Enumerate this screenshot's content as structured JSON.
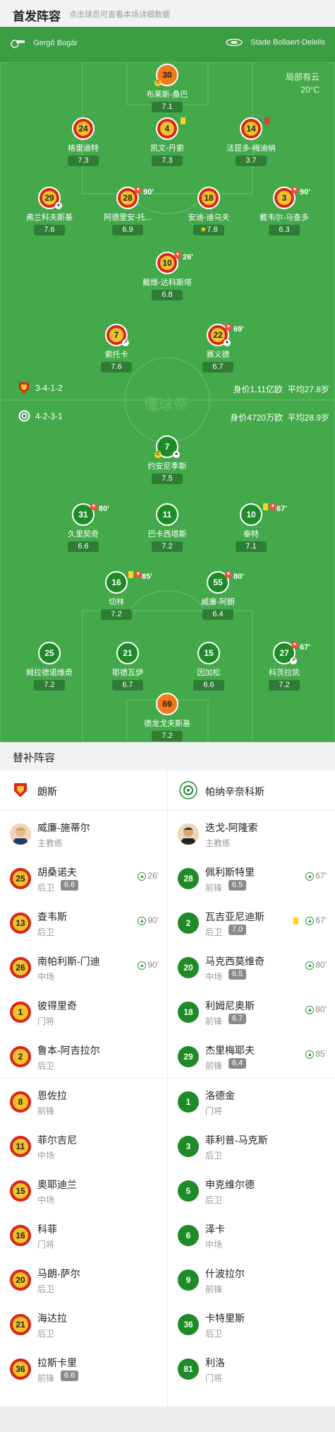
{
  "header": {
    "title": "首发阵容",
    "subtitle": "点击球员可查看本场详细数据"
  },
  "match": {
    "referee": "Gergő Bogár",
    "venue": "Stade Bollaert-Delelis",
    "weather": "局部有云",
    "temperature": "20°C",
    "watermark": "懂球帝"
  },
  "home_info": {
    "formation": "3-4-1-2",
    "value": "身价1.11亿欧",
    "age": "平均27.8岁"
  },
  "away_info": {
    "formation": "4-2-3-1",
    "value": "身价4720万欧",
    "age": "平均28.9岁"
  },
  "home_players": [
    {
      "num": "30",
      "name": "布莱斯-桑巴",
      "rating": "7.1"
    },
    {
      "num": "24",
      "name": "格雷迪特",
      "rating": "7.3"
    },
    {
      "num": "4",
      "name": "凯文-丹索",
      "rating": "7.3"
    },
    {
      "num": "14",
      "name": "法昆多-梅迪纳",
      "rating": "3.7"
    },
    {
      "num": "29",
      "name": "弗兰科夫斯基",
      "rating": "7.6"
    },
    {
      "num": "28",
      "name": "阿德里安-托...",
      "rating": "6.9",
      "sub": "90'"
    },
    {
      "num": "18",
      "name": "安迪-迪乌夫",
      "rating": "7.8"
    },
    {
      "num": "3",
      "name": "戴韦尔-马查多",
      "rating": "6.3",
      "sub": "90'"
    },
    {
      "num": "10",
      "name": "戴维-达科斯塔",
      "rating": "6.8",
      "sub": "26'"
    },
    {
      "num": "7",
      "name": "索托卡",
      "rating": "7.6"
    },
    {
      "num": "22",
      "name": "赛义德",
      "rating": "6.7",
      "sub": "69'"
    }
  ],
  "away_players": [
    {
      "num": "7",
      "name": "约安尼季斯",
      "rating": "7.5"
    },
    {
      "num": "31",
      "name": "久里契奇",
      "rating": "6.6",
      "sub": "80'"
    },
    {
      "num": "11",
      "name": "巴卡西塔斯",
      "rating": "7.2"
    },
    {
      "num": "10",
      "name": "泰特",
      "rating": "7.1",
      "sub": "67'"
    },
    {
      "num": "16",
      "name": "切林",
      "rating": "7.2",
      "sub": "85'"
    },
    {
      "num": "55",
      "name": "威廉-阿朗",
      "rating": "6.4",
      "sub": "80'"
    },
    {
      "num": "25",
      "name": "姆拉德诺维奇",
      "rating": "7.2"
    },
    {
      "num": "21",
      "name": "耶德瓦伊",
      "rating": "6.7"
    },
    {
      "num": "15",
      "name": "因加松",
      "rating": "6.6"
    },
    {
      "num": "27",
      "name": "科茨拉凯",
      "rating": "7.2",
      "sub": "67'"
    },
    {
      "num": "69",
      "name": "德龙戈夫斯基",
      "rating": "7.2"
    }
  ],
  "subs_title": "替补阵容",
  "home_team": {
    "name": "朗斯",
    "coach": "威廉-施蒂尔",
    "coach_role": "主教练"
  },
  "away_team": {
    "name": "帕纳辛奈科斯",
    "coach": "迭戈-阿隆索",
    "coach_role": "主教练"
  },
  "home_subs": [
    {
      "num": "25",
      "name": "胡桑诺夫",
      "pos": "后卫",
      "rating": "6.6",
      "in": "26'"
    },
    {
      "num": "13",
      "name": "查韦斯",
      "pos": "后卫",
      "in": "90'"
    },
    {
      "num": "26",
      "name": "南帕利斯-门迪",
      "pos": "中场",
      "in": "90'"
    },
    {
      "num": "1",
      "name": "彼得里奇",
      "pos": "门将"
    },
    {
      "num": "2",
      "name": "鲁本-阿吉拉尔",
      "pos": "后卫"
    },
    {
      "num": "8",
      "name": "恩佐拉",
      "pos": "前锋"
    },
    {
      "num": "11",
      "name": "菲尔吉尼",
      "pos": "中场"
    },
    {
      "num": "15",
      "name": "奥耶迪兰",
      "pos": "中场"
    },
    {
      "num": "16",
      "name": "科菲",
      "pos": "门将"
    },
    {
      "num": "20",
      "name": "马朗-萨尔",
      "pos": "后卫"
    },
    {
      "num": "21",
      "name": "海达拉",
      "pos": "后卫"
    },
    {
      "num": "36",
      "name": "拉斯卡里",
      "pos": "前锋",
      "rating": "6.6"
    }
  ],
  "away_subs": [
    {
      "num": "28",
      "name": "佩利斯特里",
      "pos": "前锋",
      "rating": "6.5",
      "in": "67'"
    },
    {
      "num": "2",
      "name": "瓦吉亚尼迪斯",
      "pos": "后卫",
      "rating": "7.0",
      "in": "67'",
      "card": "yellow"
    },
    {
      "num": "20",
      "name": "马克西莫维奇",
      "pos": "中场",
      "rating": "6.5",
      "in": "80'"
    },
    {
      "num": "18",
      "name": "利姆尼奥斯",
      "pos": "前锋",
      "rating": "6.7",
      "in": "80'"
    },
    {
      "num": "29",
      "name": "杰里梅耶夫",
      "pos": "前锋",
      "rating": "6.4",
      "in": "85'"
    },
    {
      "num": "1",
      "name": "洛德金",
      "pos": "门将"
    },
    {
      "num": "3",
      "name": "菲利普-马克斯",
      "pos": "后卫"
    },
    {
      "num": "5",
      "name": "申克维尔德",
      "pos": "后卫"
    },
    {
      "num": "6",
      "name": "泽卡",
      "pos": "中场"
    },
    {
      "num": "9",
      "name": "什波拉尔",
      "pos": "前锋"
    },
    {
      "num": "36",
      "name": "卡特里斯",
      "pos": "后卫"
    },
    {
      "num": "81",
      "name": "利洛",
      "pos": "门将"
    }
  ],
  "colors": {
    "pitch": "#43a94a",
    "home_primary": "#f1c22a",
    "home_secondary": "#d9261c",
    "away_primary": "#1f8a28",
    "gk": "#f07a1a"
  }
}
